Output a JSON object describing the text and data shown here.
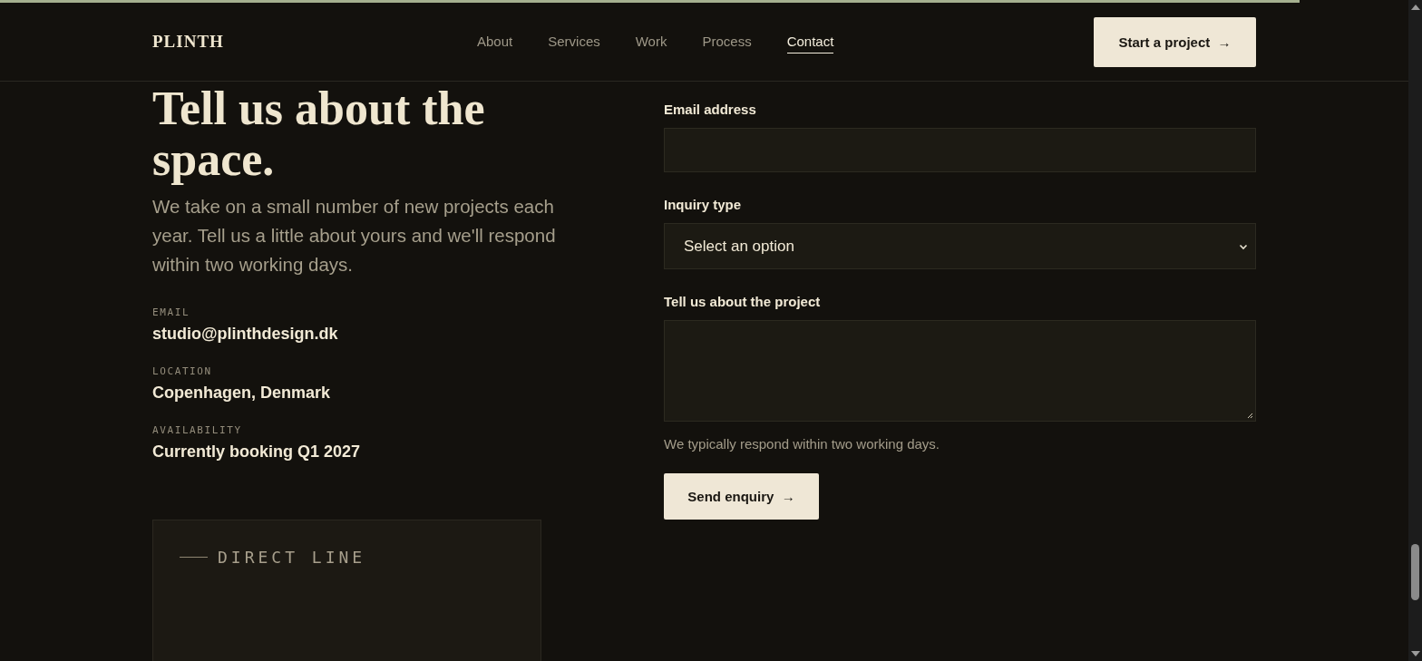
{
  "scroll_progress": {
    "level": 0.923
  },
  "header": {
    "logo": "PLINTH",
    "nav": [
      {
        "label": "About",
        "selected": false
      },
      {
        "label": "Services",
        "selected": false
      },
      {
        "label": "Work",
        "selected": false
      },
      {
        "label": "Process",
        "selected": false
      },
      {
        "label": "Contact",
        "selected": true
      }
    ],
    "cta": "Start a project  →"
  },
  "intro": {
    "heading": "Tell us about the space.",
    "text": "We take on a small number of new projects each year. Tell us a little about yours and we'll respond within two working days.",
    "details": [
      {
        "label": "EMAIL",
        "value": "studio@plinthdesign.dk"
      },
      {
        "label": "LOCATION",
        "value": "Copenhagen, Denmark"
      },
      {
        "label": "AVAILABILITY",
        "value": "Currently booking Q1 2027"
      }
    ]
  },
  "direct_line": {
    "title": "DIRECT LINE"
  },
  "form": {
    "fields": [
      {
        "kind": "input",
        "label": "Email address"
      },
      {
        "kind": "select",
        "label": "Inquiry type",
        "value": "Select an option"
      },
      {
        "kind": "textarea",
        "label": "Tell us about the project"
      }
    ],
    "hint": "We typically respond within two working days.",
    "submit": "Send enquiry  →"
  }
}
